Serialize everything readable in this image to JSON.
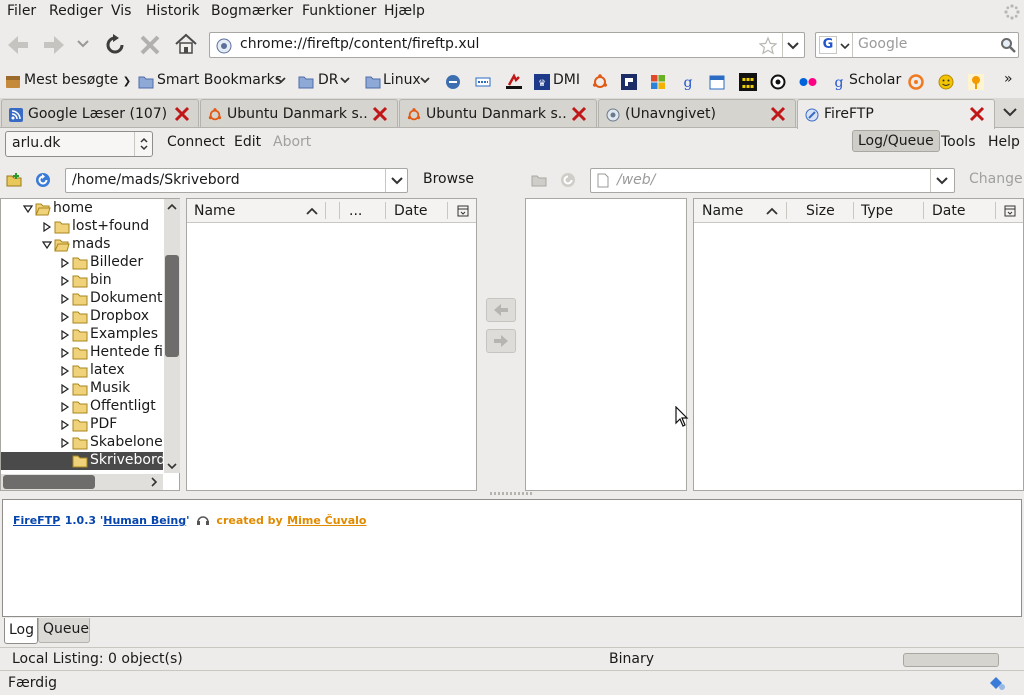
{
  "menu": [
    "Filer",
    "Rediger",
    "Vis",
    "Historik",
    "Bogmærker",
    "Funktioner",
    "Hjælp"
  ],
  "nav": {
    "url": "chrome://fireftp/content/fireftp.xul",
    "search_engine": "G",
    "search_placeholder": "Google"
  },
  "bookmarks": {
    "most_visited": "Mest besøgte",
    "smart": "Smart Bookmarks",
    "dr": "DR",
    "linux": "Linux",
    "dmi": "DMI",
    "scholar": "Scholar",
    "more": "»"
  },
  "tabs": [
    {
      "label": "Google Læser (107)"
    },
    {
      "label": "Ubuntu Danmark s..."
    },
    {
      "label": "Ubuntu Danmark s..."
    },
    {
      "label": "(Unavngivet)"
    },
    {
      "label": "FireFTP"
    }
  ],
  "ftp_toolbar": {
    "account": "arlu.dk",
    "connect": "Connect",
    "edit": "Edit",
    "abort": "Abort",
    "logqueue": "Log/Queue",
    "tools": "Tools",
    "help": "Help"
  },
  "local": {
    "path": "/home/mads/Skrivebord",
    "browse": "Browse",
    "tree": [
      {
        "label": "home",
        "level": 0,
        "expanded": true
      },
      {
        "label": "lost+found",
        "level": 1,
        "expanded": false
      },
      {
        "label": "mads",
        "level": 1,
        "expanded": true
      },
      {
        "label": "Billeder",
        "level": 2,
        "expanded": false
      },
      {
        "label": "bin",
        "level": 2,
        "expanded": false
      },
      {
        "label": "Dokumenter",
        "level": 2,
        "expanded": false
      },
      {
        "label": "Dropbox",
        "level": 2,
        "expanded": false
      },
      {
        "label": "Examples",
        "level": 2,
        "expanded": false
      },
      {
        "label": "Hentede filer",
        "level": 2,
        "expanded": false
      },
      {
        "label": "latex",
        "level": 2,
        "expanded": false
      },
      {
        "label": "Musik",
        "level": 2,
        "expanded": false
      },
      {
        "label": "Offentligt",
        "level": 2,
        "expanded": false
      },
      {
        "label": "PDF",
        "level": 2,
        "expanded": false
      },
      {
        "label": "Skabeloner",
        "level": 2,
        "expanded": false
      },
      {
        "label": "Skrivebord",
        "level": 2,
        "selected": true
      }
    ],
    "columns": {
      "name": "Name",
      "extra": "...",
      "date": "Date"
    }
  },
  "remote": {
    "path": "/web/",
    "change": "Change",
    "columns": {
      "name": "Name",
      "size": "Size",
      "type": "Type",
      "date": "Date"
    }
  },
  "log": {
    "app": "FireFTP",
    "version": "1.0.3 '",
    "codename": "Human Being",
    "quote_end": "'",
    "created_by": "created by",
    "author": "Mime Čuvalo"
  },
  "bottom_tabs": {
    "log": "Log",
    "queue": "Queue"
  },
  "status": {
    "listing": "Local Listing: 0 object(s)",
    "mode": "Binary",
    "done": "Færdig"
  },
  "colors": {
    "selection": "#4a4a4a",
    "link": "#0645ad",
    "orange": "#e08a00",
    "close_red": "#c01818"
  }
}
